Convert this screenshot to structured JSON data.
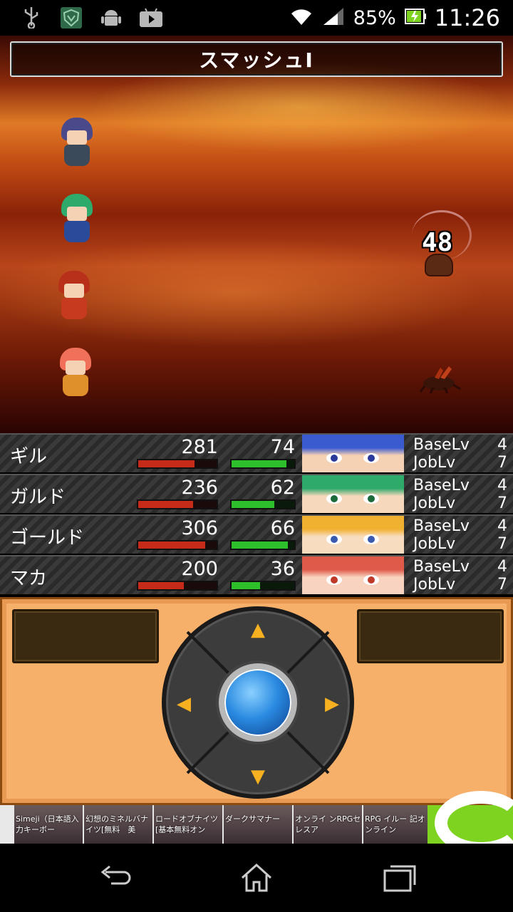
{
  "status_bar": {
    "left_icons": [
      "usb-icon",
      "shield-app-icon",
      "android-icon",
      "youtube-icon"
    ],
    "battery_percent": "85%",
    "time": "11:26"
  },
  "battle": {
    "skill_name": "スマッシュI",
    "damage_number": "48"
  },
  "party": [
    {
      "name": "ギル",
      "hp": "281",
      "mp": "74",
      "hp_fraction": 0.72,
      "mp_fraction": 0.88,
      "base_label": "BaseLv",
      "base_lv": "4",
      "job_label": "JobLv",
      "job_lv": "7"
    },
    {
      "name": "ガルド",
      "hp": "236",
      "mp": "62",
      "hp_fraction": 0.7,
      "mp_fraction": 0.68,
      "base_label": "BaseLv",
      "base_lv": "4",
      "job_label": "JobLv",
      "job_lv": "7"
    },
    {
      "name": "ゴールド",
      "hp": "306",
      "mp": "66",
      "hp_fraction": 0.85,
      "mp_fraction": 0.9,
      "base_label": "BaseLv",
      "base_lv": "4",
      "job_label": "JobLv",
      "job_lv": "7"
    },
    {
      "name": "マカ",
      "hp": "200",
      "mp": "36",
      "hp_fraction": 0.58,
      "mp_fraction": 0.45,
      "base_label": "BaseLv",
      "base_lv": "4",
      "job_label": "JobLv",
      "job_lv": "7"
    }
  ],
  "ads": [
    {
      "label": "Simeji（日本語入力キーボー"
    },
    {
      "label": "幻想のミネルバナイツ[無料　美"
    },
    {
      "label": "ロードオブナイツ[基本無料オン"
    },
    {
      "label": "ダークサマナー"
    },
    {
      "label": "オンライ ンRPGセレスア"
    },
    {
      "label": "RPG イルー 記オンライン"
    }
  ],
  "colors": {
    "hp_bar": "#c62a18",
    "mp_bar": "#2ec02a",
    "pad_bg": "#f6b06a",
    "dpad_arrow": "#f6b020"
  }
}
